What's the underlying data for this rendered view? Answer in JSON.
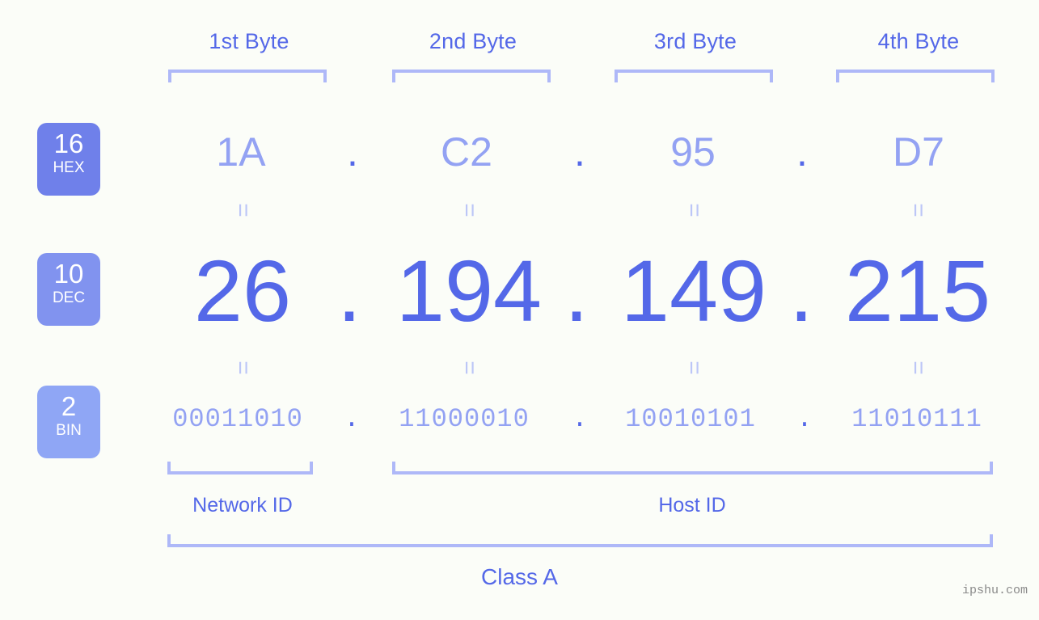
{
  "page": {
    "background_color": "#fbfdf8",
    "accent_strong": "#5468e8",
    "accent_light": "#93a2f3",
    "accent_bracket": "#aeb8f8"
  },
  "byte_headers": [
    {
      "label": "1st Byte"
    },
    {
      "label": "2nd Byte"
    },
    {
      "label": "3rd Byte"
    },
    {
      "label": "4th Byte"
    }
  ],
  "radix_badges": [
    {
      "number": "16",
      "name": "HEX",
      "color": "#6f80ea"
    },
    {
      "number": "10",
      "name": "DEC",
      "color": "#8193ef"
    },
    {
      "number": "2",
      "name": "BIN",
      "color": "#8fa6f5"
    }
  ],
  "rows": {
    "hex": {
      "radix": "16",
      "radix_name": "HEX",
      "octets": [
        "1A",
        "C2",
        "95",
        "D7"
      ],
      "separator": "."
    },
    "dec": {
      "radix": "10",
      "radix_name": "DEC",
      "octets": [
        "26",
        "194",
        "149",
        "215"
      ],
      "separator": "."
    },
    "bin": {
      "radix": "2",
      "radix_name": "BIN",
      "octets": [
        "00011010",
        "11000010",
        "10010101",
        "11010111"
      ],
      "separator": "."
    }
  },
  "equality_marks": {
    "symbol": "=",
    "between_hex_dec": [
      "=",
      "=",
      "=",
      "="
    ],
    "between_dec_bin": [
      "=",
      "=",
      "=",
      "="
    ]
  },
  "id_sections": [
    {
      "label": "Network ID"
    },
    {
      "label": "Host ID"
    }
  ],
  "class_section": {
    "label": "Class A"
  },
  "watermark": {
    "text": "ipshu.com"
  }
}
